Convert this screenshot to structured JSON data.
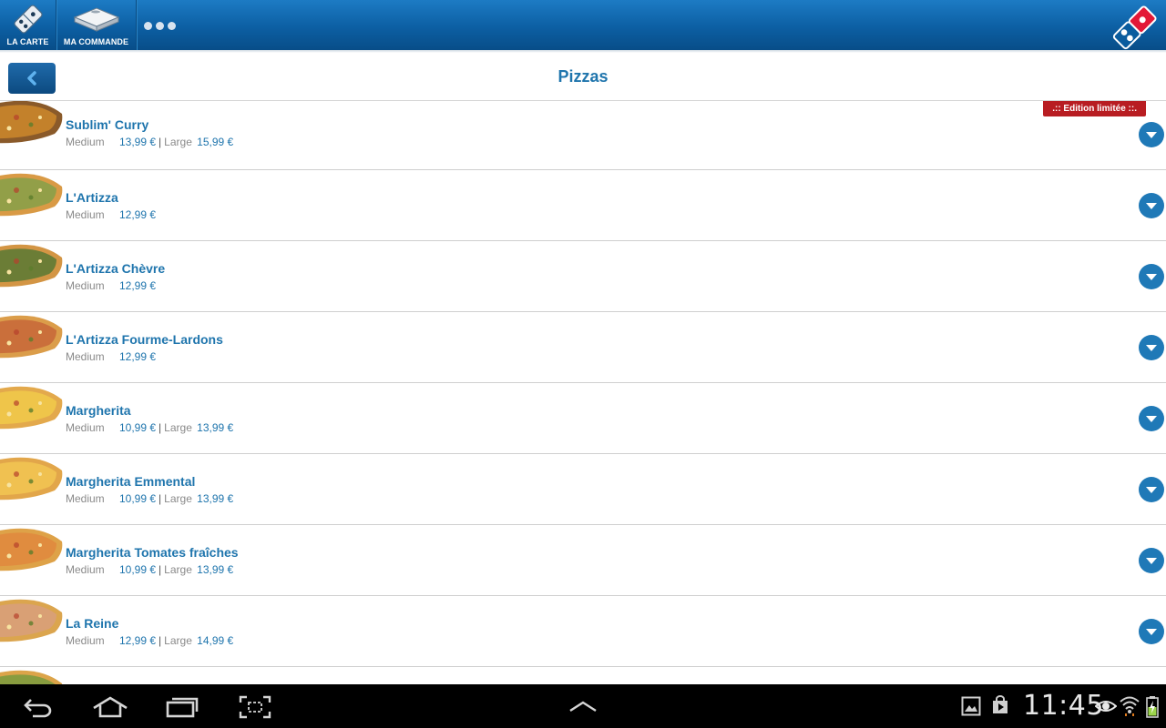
{
  "topbar": {
    "menu_label": "LA CARTE",
    "order_label": "MA COMMANDE",
    "more_icon": "ellipsis-icon",
    "brand_colors": {
      "blue": "#0c5fa3",
      "red": "#e31837"
    }
  },
  "header": {
    "title": "Pizzas",
    "back_icon": "chevron-left-icon"
  },
  "pizzas": [
    {
      "name": "Sublim' Curry",
      "badge": ".:: Edition limitée ::.",
      "sizes": [
        {
          "size": "Medium",
          "price": "13,99 €"
        },
        {
          "size": "Large",
          "price": "15,99 €"
        }
      ],
      "crust": "#8a5a2a",
      "top": "#c9852b"
    },
    {
      "name": "L'Artizza",
      "badge": "",
      "sizes": [
        {
          "size": "Medium",
          "price": "12,99 €"
        }
      ],
      "crust": "#d99a45",
      "top": "#8aa048"
    },
    {
      "name": "L'Artizza Chèvre",
      "badge": "",
      "sizes": [
        {
          "size": "Medium",
          "price": "12,99 €"
        }
      ],
      "crust": "#d39544",
      "top": "#5f7a35"
    },
    {
      "name": "L'Artizza Fourme-Lardons",
      "badge": "",
      "sizes": [
        {
          "size": "Medium",
          "price": "12,99 €"
        }
      ],
      "crust": "#db9d4a",
      "top": "#c86a3a"
    },
    {
      "name": "Margherita",
      "badge": "",
      "sizes": [
        {
          "size": "Medium",
          "price": "10,99 €"
        },
        {
          "size": "Large",
          "price": "13,99 €"
        }
      ],
      "crust": "#e3a94c",
      "top": "#f0c84a"
    },
    {
      "name": "Margherita Emmental",
      "badge": "",
      "sizes": [
        {
          "size": "Medium",
          "price": "10,99 €"
        },
        {
          "size": "Large",
          "price": "13,99 €"
        }
      ],
      "crust": "#e2a64a",
      "top": "#f2c452"
    },
    {
      "name": "Margherita Tomates fraîches",
      "badge": "",
      "sizes": [
        {
          "size": "Medium",
          "price": "10,99 €"
        },
        {
          "size": "Large",
          "price": "13,99 €"
        }
      ],
      "crust": "#dea248",
      "top": "#e08a3e"
    },
    {
      "name": "La Reine",
      "badge": "",
      "sizes": [
        {
          "size": "Medium",
          "price": "12,99 €"
        },
        {
          "size": "Large",
          "price": "14,99 €"
        }
      ],
      "crust": "#dba54e",
      "top": "#d8a07a"
    },
    {
      "name": "",
      "badge": "",
      "sizes": [],
      "crust": "#dca449",
      "top": "#7e9b3e"
    }
  ],
  "system": {
    "time": "11:45",
    "icons": [
      "back-icon",
      "home-icon",
      "recent-apps-icon",
      "screenshot-icon",
      "up-chevron-icon",
      "gallery-icon",
      "play-store-icon",
      "eye-icon",
      "wifi-icon",
      "battery-icon"
    ]
  }
}
